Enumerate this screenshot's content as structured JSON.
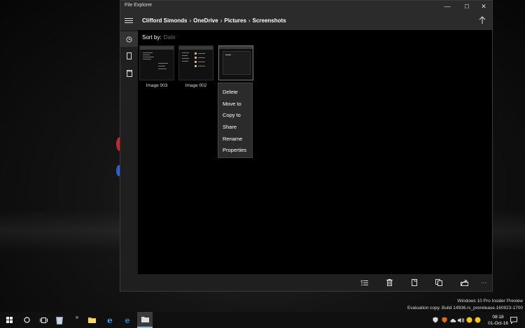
{
  "window": {
    "title": "File Explorer",
    "controls": {
      "minimize": "—",
      "maximize": "☐",
      "close": "✕"
    }
  },
  "breadcrumb": [
    "Clifford Simonds",
    "OneDrive",
    "Pictures",
    "Screenshots"
  ],
  "breadcrumb_sep": "›",
  "sort": {
    "label": "Sort by:",
    "value": "Date"
  },
  "files": [
    {
      "name": "Image 003"
    },
    {
      "name": "Image 002"
    },
    {
      "name": ""
    }
  ],
  "context_menu": [
    "Delete",
    "Move to",
    "Copy to",
    "Share",
    "Rename",
    "Properties"
  ],
  "command_bar": [
    "select-icon",
    "delete-icon",
    "new-item-icon",
    "copy-icon",
    "share-icon",
    "more-icon"
  ],
  "more_label": "···",
  "watermark": {
    "line1": "Windows 10 Pro Insider Preview",
    "line2": "Evaluation copy. Build 14936.rs_prerelease.160923-1700"
  },
  "taskbar": {
    "time": "08:18",
    "date": "01-Oct-16",
    "overflow": "»"
  },
  "colors": {
    "accent": "#0078d7",
    "window_bg": "#000000",
    "chrome": "#2b2b2b"
  }
}
